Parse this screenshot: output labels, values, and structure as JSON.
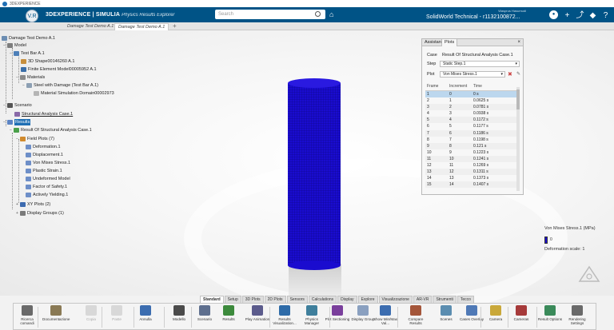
{
  "window": {
    "title": "3DEXPERIENCE"
  },
  "topbar": {
    "compass_label": "V.R",
    "brand_bold": "3DEXPERIENCE | SIMULIA",
    "brand_app": "Physics Results Explorer",
    "search_placeholder": "Search",
    "user_line": "Wasprus Hasumudi",
    "user_title": "SolidWorld Technical - r1132100872..."
  },
  "tabs": [
    {
      "label": "Damage Test Demo A.1 (Exp)"
    },
    {
      "label": "Damage Test Demo A.1"
    }
  ],
  "tree": {
    "root": "Damage Test Demo A.1",
    "model": "Model",
    "test_bar": "Test Bar A.1",
    "shape": "3D Shape00146260 A.1",
    "fem": "Finite Element Model00005952 A.1",
    "materials": "Materials",
    "steel": "Steel with Damage (Test Bar A.1)",
    "material_sim": "Material Simulation Domain00002973",
    "scenario": "Scenario",
    "structural_case": "Structural Analysis Case.1",
    "results": "Results",
    "result_of": "Result Of Structural Analysis Case.1",
    "field_plots": "Field Plots (7)",
    "fp": [
      "Deformation.1",
      "Displacement.1",
      "Von Mises Stress.1",
      "Plastic Strain.1",
      "Undeformed Model",
      "Factor of Safety.1",
      "Actively Yielding.1"
    ],
    "xy_plots": "XY Plots (2)",
    "display_groups": "Display Groups (1)"
  },
  "panel": {
    "tabs": [
      "Assistant",
      "Plots"
    ],
    "case_label": "Case",
    "case_value": "Result Of Structural Analysis Case.1",
    "step_label": "Step",
    "step_value": "Static Step.1",
    "plot_label": "Plot",
    "plot_value": "Von Mises Stress.1",
    "columns": [
      "Frame",
      "Increment",
      "Time"
    ],
    "rows": [
      [
        "1",
        "0",
        "0 s"
      ],
      [
        "2",
        "1",
        "0.0625 s"
      ],
      [
        "3",
        "2",
        "0.0781 s"
      ],
      [
        "4",
        "3",
        "0.0938 s"
      ],
      [
        "5",
        "4",
        "0.1172 s"
      ],
      [
        "6",
        "5",
        "0.1177 s"
      ],
      [
        "7",
        "6",
        "0.1186 s"
      ],
      [
        "8",
        "7",
        "0.1198 s"
      ],
      [
        "9",
        "8",
        "0.121 s"
      ],
      [
        "10",
        "9",
        "0.1223 s"
      ],
      [
        "11",
        "10",
        "0.1241 s"
      ],
      [
        "12",
        "11",
        "0.1269 s"
      ],
      [
        "13",
        "12",
        "0.1311 s"
      ],
      [
        "14",
        "13",
        "0.1373 s"
      ],
      [
        "15",
        "14",
        "0.1407 s"
      ]
    ]
  },
  "legend": {
    "title": "Von Mises Stress.1 (MPa)",
    "value": "0",
    "scale": "Deformation scale: 1"
  },
  "colors": {
    "brand": "#005386",
    "plot_blue": "#1a0ccf"
  },
  "bottom_tabs": [
    "Standard",
    "Setup",
    "3D Plots",
    "2D Plots",
    "Sensors",
    "Calculations",
    "Display",
    "Explore",
    "Visualizzazione",
    "AR-VR",
    "Strumenti",
    "Tecco"
  ],
  "toolbar": {
    "items": [
      "Ricerca comandi",
      "Documentazione",
      "Copia",
      "Paste",
      "Annulla",
      "Modello",
      "Scenario",
      "Results",
      "Play Animation",
      "Results Visualization...",
      "Physics Manager",
      "Plot Sectioning",
      "Display Group",
      "Show Min/Max Val...",
      "Compare Results",
      "Scenes",
      "Cases Overlay",
      "Camera",
      "Cameras",
      "Result Options",
      "Rendering Settings"
    ]
  }
}
